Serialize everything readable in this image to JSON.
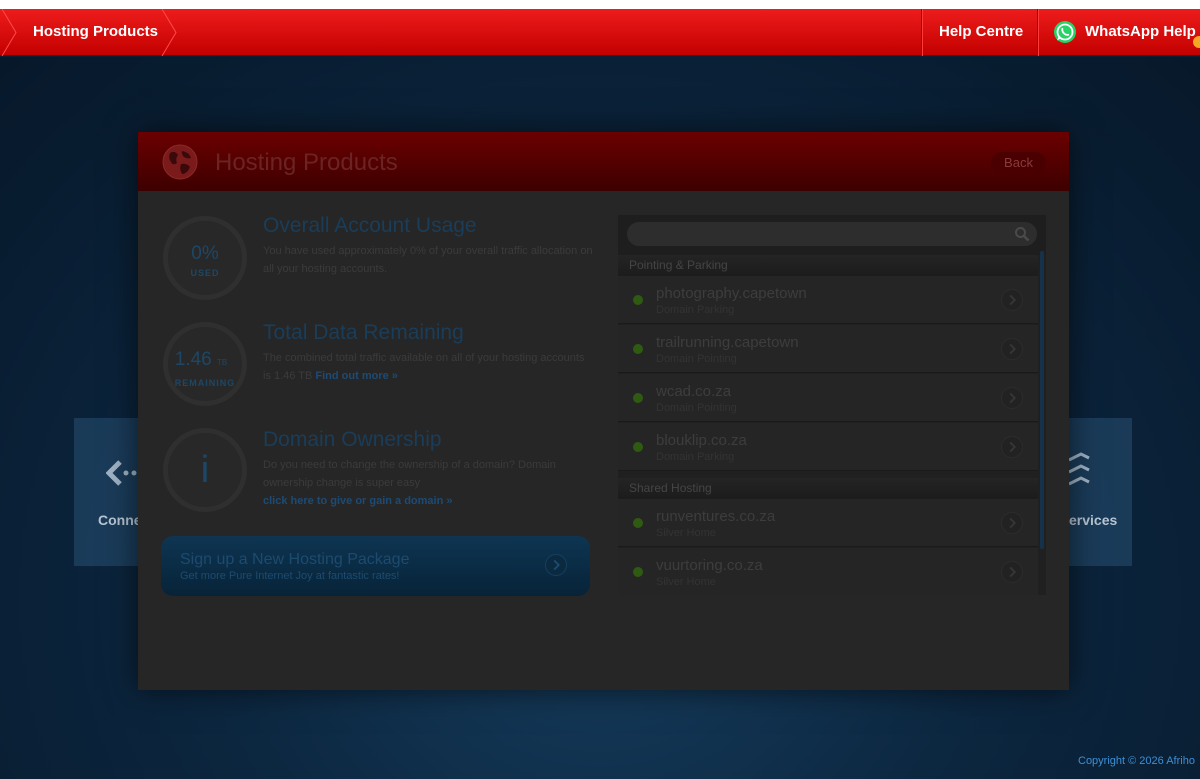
{
  "topbar": {
    "title": "Hosting Products",
    "help_label": "Help Centre",
    "whatsapp_label": "WhatsApp Help"
  },
  "background": {
    "tile_left_label": "Conne",
    "tile_right_label": "ervices",
    "copyright": "Copyright © 2026 Afriho"
  },
  "modal": {
    "title": "Hosting Products",
    "back_label": "Back",
    "usage": {
      "value": "0%",
      "caption": "USED",
      "title": "Overall Account Usage",
      "text": "You have used approximately 0% of your overall traffic allocation on all your hosting accounts."
    },
    "remaining": {
      "value": "1.46",
      "unit": "TB",
      "caption": "REMAINING",
      "title": "Total Data Remaining",
      "text": "The combined total traffic available on all of your hosting accounts is   1.46 TB ",
      "link": "Find out more »"
    },
    "ownership": {
      "icon_glyph": "i",
      "title": "Domain Ownership",
      "text": "Do you need to change the ownership of a domain? Domain ownership change is super easy",
      "link": "click here to give or gain a domain »"
    },
    "signup": {
      "title": "Sign up a New Hosting Package",
      "subtitle": "Get more Pure Internet Joy at fantastic rates!"
    },
    "search": {
      "placeholder": ""
    },
    "groups": [
      {
        "heading": "Pointing & Parking",
        "items": [
          {
            "name": "photography.capetown",
            "type": "Domain Parking"
          },
          {
            "name": "trailrunning.capetown",
            "type": "Domain Pointing"
          },
          {
            "name": "wcad.co.za",
            "type": "Domain Pointing"
          },
          {
            "name": "blouklip.co.za",
            "type": "Domain Parking"
          }
        ]
      },
      {
        "heading": "Shared Hosting",
        "items": [
          {
            "name": "runventures.co.za",
            "type": "Silver Home"
          },
          {
            "name": "vuurtoring.co.za",
            "type": "Silver Home"
          }
        ]
      }
    ]
  },
  "colors": {
    "topbar_red": "#e50000",
    "modal_bg": "#262626",
    "status_green": "#2f5a12",
    "link_blue": "#1d4b74",
    "whatsapp_green": "#25d366",
    "notification_orange": "#f5a623"
  }
}
